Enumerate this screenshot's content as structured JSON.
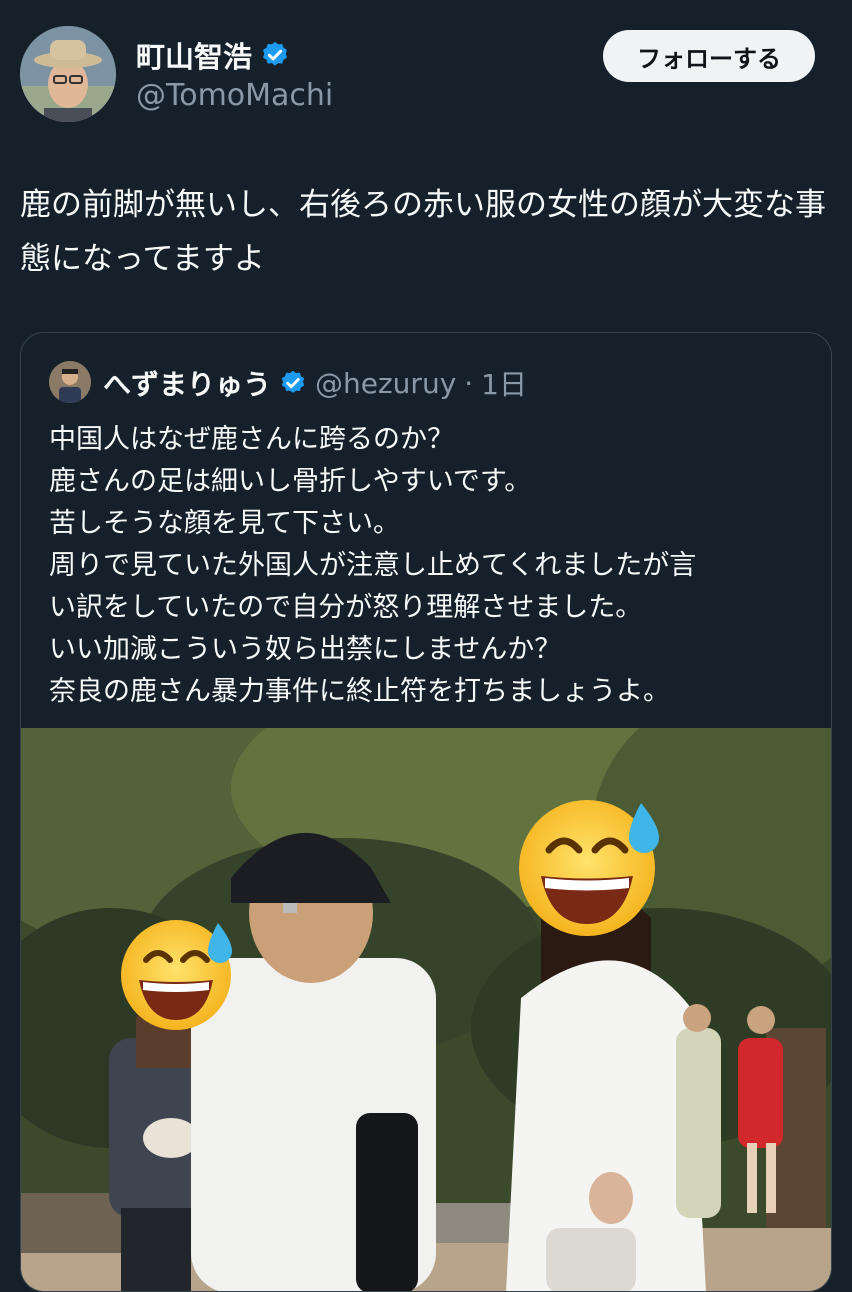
{
  "author": {
    "name": "町山智浩",
    "handle": "@TomoMachi",
    "verified_color": "#1d9bf0"
  },
  "follow_button": {
    "label": "フォローする"
  },
  "tweet": {
    "text": "鹿の前脚が無いし、右後ろの赤い服の女性の顔が大変な事態になってますよ"
  },
  "quoted": {
    "name": "へずまりゅう",
    "handle": "@hezuruy",
    "time": "1日",
    "separator": "·",
    "lines": [
      "中国人はなぜ鹿さんに跨るのか？",
      "鹿さんの足は細いし骨折しやすいです。",
      "苦しそうな顔を見て下さい。",
      "周りで見ていた外国人が注意し止めてくれましたが言",
      "い訳をしていたので自分が怒り理解させました。",
      "いい加減こういう奴ら出禁にしませんか？",
      "奈良の鹿さん暴力事件に終止符を打ちましょうよ。"
    ]
  },
  "photo": {
    "emoji_icon": "grinning-sweat-emoji"
  }
}
